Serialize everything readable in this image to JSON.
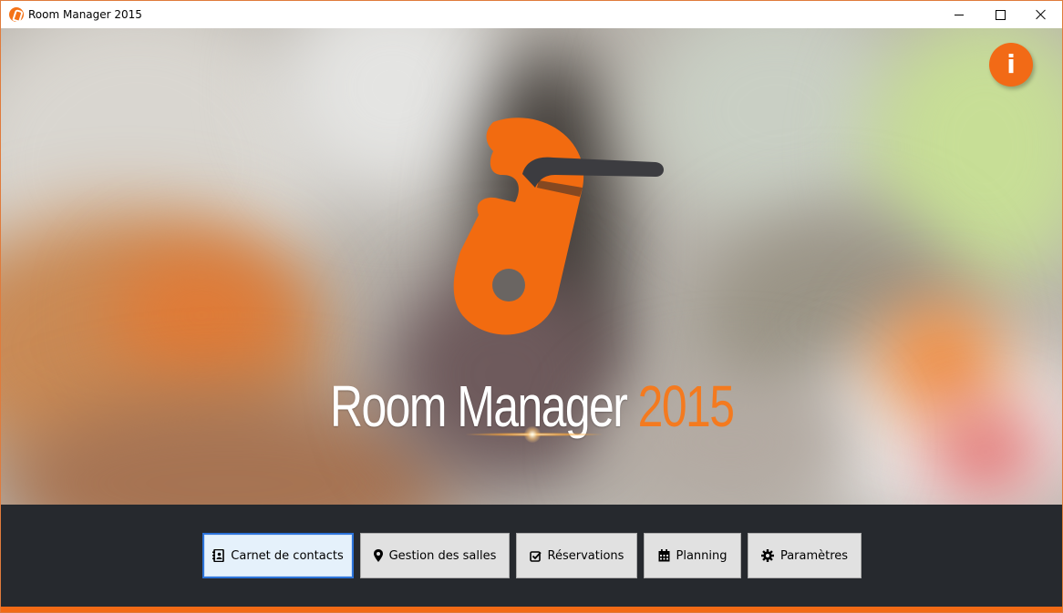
{
  "window": {
    "title": "Room Manager 2015",
    "accent_color": "#f26a16",
    "controls": [
      "minimize-icon",
      "maximize-icon",
      "close-icon"
    ]
  },
  "hero": {
    "title_name": "Room Manager",
    "title_year": "2015",
    "info_label": "i",
    "logo_icon": "door-hanger-logo-icon"
  },
  "nav": {
    "buttons": [
      {
        "label": "Carnet de contacts",
        "icon": "address-book-icon"
      },
      {
        "label": "Gestion des salles",
        "icon": "map-marker-icon"
      },
      {
        "label": "Réservations",
        "icon": "checkbox-icon"
      },
      {
        "label": "Planning",
        "icon": "calendar-icon"
      },
      {
        "label": "Paramètres",
        "icon": "gear-icon"
      }
    ]
  }
}
